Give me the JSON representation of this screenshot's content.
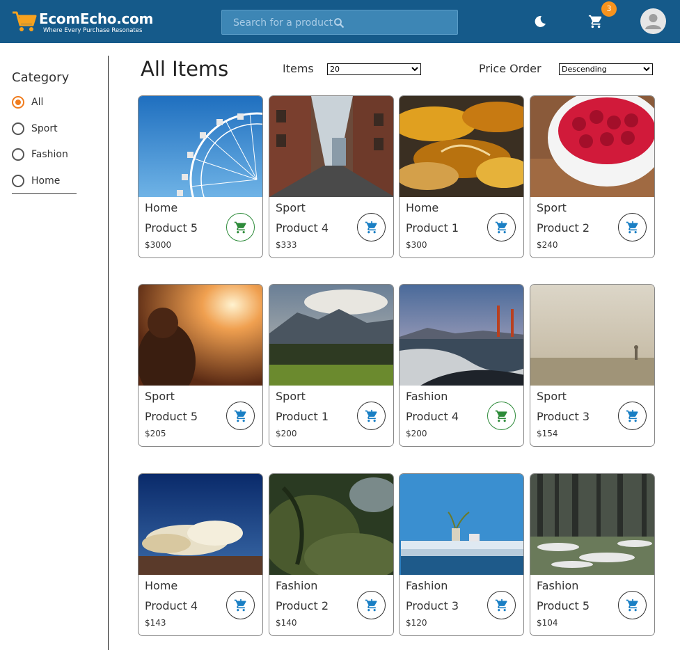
{
  "header": {
    "brand": "EcomEcho.com",
    "tagline": "Where Every Purchase Resonates",
    "search_placeholder": "Search for a product",
    "cart_count": "3",
    "colors": {
      "bar": "#155a8a",
      "badge": "#f7931e",
      "accent": "#f07c1e"
    }
  },
  "sidebar": {
    "title": "Category",
    "items": [
      {
        "label": "All",
        "selected": true
      },
      {
        "label": "Sport",
        "selected": false
      },
      {
        "label": "Fashion",
        "selected": false
      },
      {
        "label": "Home",
        "selected": false
      }
    ]
  },
  "main": {
    "title": "All Items",
    "items_label": "Items",
    "items_value": "20",
    "price_label": "Price Order",
    "price_value": "Descending"
  },
  "products": [
    {
      "category": "Home",
      "name": "Product 5",
      "price": "$3000",
      "in_cart": true,
      "image": "ferris-wheel"
    },
    {
      "category": "Sport",
      "name": "Product 4",
      "price": "$333",
      "in_cart": false,
      "image": "alley"
    },
    {
      "category": "Home",
      "name": "Product 1",
      "price": "$300",
      "in_cart": false,
      "image": "autumn-leaves"
    },
    {
      "category": "Sport",
      "name": "Product 2",
      "price": "$240",
      "in_cart": false,
      "image": "raspberries"
    },
    {
      "category": "Sport",
      "name": "Product 5",
      "price": "$205",
      "in_cart": false,
      "image": "sunset-person"
    },
    {
      "category": "Sport",
      "name": "Product 1",
      "price": "$200",
      "in_cart": false,
      "image": "mountains"
    },
    {
      "category": "Fashion",
      "name": "Product 4",
      "price": "$200",
      "in_cart": true,
      "image": "beach-bridge"
    },
    {
      "category": "Sport",
      "name": "Product 3",
      "price": "$154",
      "in_cart": false,
      "image": "fog"
    },
    {
      "category": "Home",
      "name": "Product 4",
      "price": "$143",
      "in_cart": false,
      "image": "clouds"
    },
    {
      "category": "Fashion",
      "name": "Product 2",
      "price": "$140",
      "in_cart": false,
      "image": "moss"
    },
    {
      "category": "Fashion",
      "name": "Product 3",
      "price": "$120",
      "in_cart": false,
      "image": "blue-table"
    },
    {
      "category": "Fashion",
      "name": "Product 5",
      "price": "$104",
      "in_cart": false,
      "image": "forest-snow"
    }
  ]
}
